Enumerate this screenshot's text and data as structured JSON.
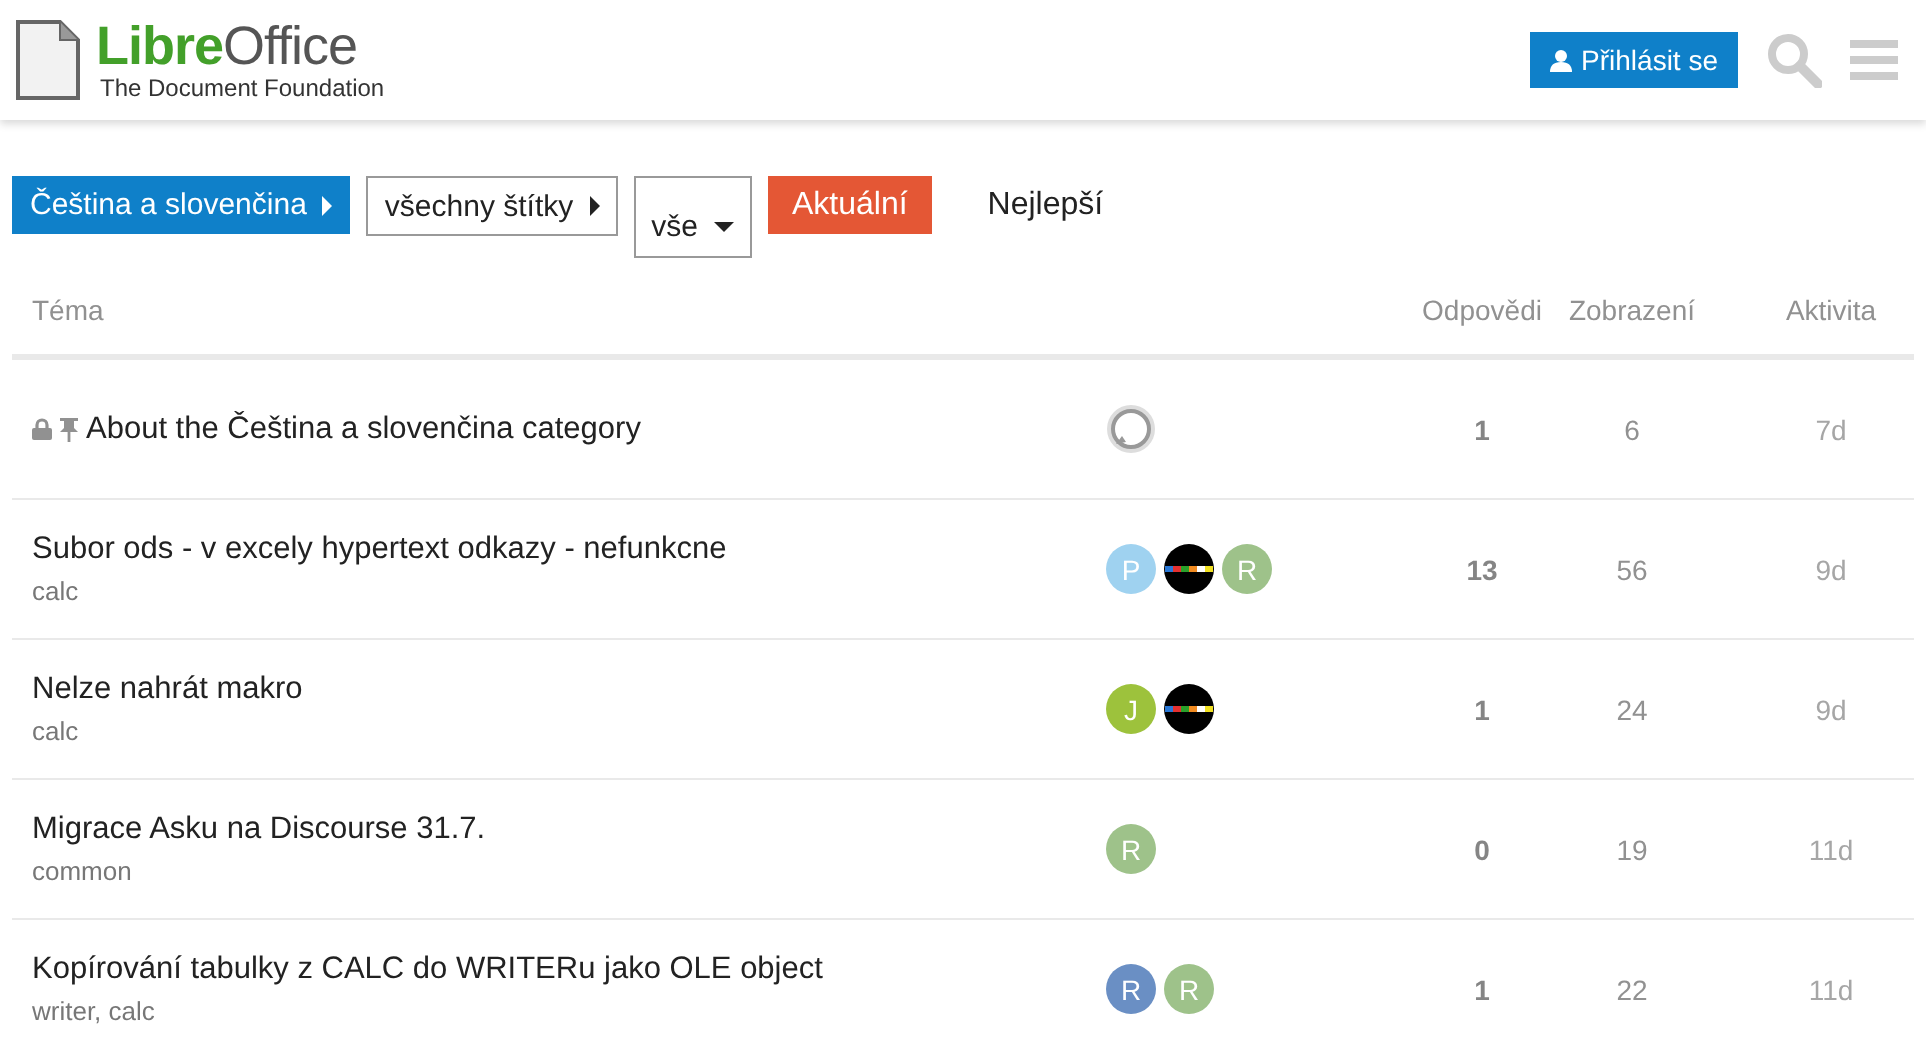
{
  "header": {
    "logo": {
      "name_first": "Libre",
      "name_second": "Office",
      "tagline": "The Document Foundation"
    },
    "login_button": "Přihlásit se"
  },
  "nav": {
    "category": "Čeština a slovenčina",
    "tags": "všechny štítky",
    "filter": "vše",
    "tabs": [
      {
        "label": "Aktuální",
        "selected": true
      },
      {
        "label": "Nejlepší",
        "selected": false
      }
    ]
  },
  "table": {
    "columns": [
      "Téma",
      "Odpovědi",
      "Zobrazení",
      "Aktivita"
    ],
    "rows": [
      {
        "title": "About the Čeština a slovenčina category",
        "locked": true,
        "pinned": true,
        "posters": [
          {
            "kind": "system"
          }
        ],
        "replies": "1",
        "views": "6",
        "activity": "7d"
      },
      {
        "title": "Subor ods - v excely hypertext odkazy - nefunkcne",
        "tags": "calc",
        "locked": false,
        "pinned": false,
        "posters": [
          {
            "kind": "letter",
            "letter": "P",
            "color": "#9fd2f0"
          },
          {
            "kind": "stripe"
          },
          {
            "kind": "letter",
            "letter": "R",
            "color": "#9ec28a"
          }
        ],
        "replies": "13",
        "views": "56",
        "activity": "9d"
      },
      {
        "title": "Nelze nahrát makro",
        "tags": "calc",
        "locked": false,
        "pinned": false,
        "posters": [
          {
            "kind": "letter",
            "letter": "J",
            "color": "#9dc23c"
          },
          {
            "kind": "stripe"
          }
        ],
        "replies": "1",
        "views": "24",
        "activity": "9d"
      },
      {
        "title": "Migrace Asku na Discourse 31.7.",
        "tags": "common",
        "locked": false,
        "pinned": false,
        "posters": [
          {
            "kind": "letter",
            "letter": "R",
            "color": "#9ec28a"
          }
        ],
        "replies": "0",
        "views": "19",
        "activity": "11d"
      },
      {
        "title": "Kopírování tabulky z CALC do WRITERu jako OLE object",
        "tags": "writer,  calc",
        "locked": false,
        "pinned": false,
        "posters": [
          {
            "kind": "letter",
            "letter": "R",
            "color": "#6a8fc4"
          },
          {
            "kind": "letter",
            "letter": "R",
            "color": "#9ec28a"
          }
        ],
        "replies": "1",
        "views": "22",
        "activity": "11d"
      }
    ]
  }
}
